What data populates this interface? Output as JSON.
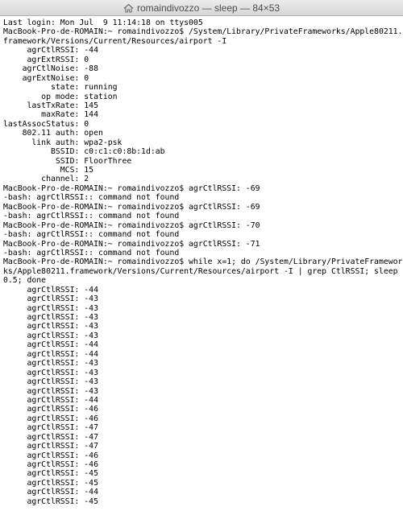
{
  "window": {
    "title": "romaindivozzo — sleep — 84×53",
    "title_icon": "home-folder-icon"
  },
  "terminal": {
    "lines": [
      "Last login: Mon Jul  9 11:14:18 on ttys005",
      "MacBook-Pro-de-ROMAIN:~ romaindivozzo$ /System/Library/PrivateFrameworks/Apple80211.",
      "framework/Versions/Current/Resources/airport -I",
      "     agrCtlRSSI: -44",
      "     agrExtRSSI: 0",
      "    agrCtlNoise: -88",
      "    agrExtNoise: 0",
      "          state: running",
      "        op mode: station",
      "     lastTxRate: 145",
      "        maxRate: 144",
      "lastAssocStatus: 0",
      "    802.11 auth: open",
      "      link auth: wpa2-psk",
      "          BSSID: c0:c1:c0:8b:1d:ab",
      "           SSID: FloorThree",
      "            MCS: 15",
      "        channel: 2",
      "MacBook-Pro-de-ROMAIN:~ romaindivozzo$ agrCtlRSSI: -69",
      "-bash: agrCtlRSSI:: command not found",
      "MacBook-Pro-de-ROMAIN:~ romaindivozzo$ agrCtlRSSI: -69",
      "-bash: agrCtlRSSI:: command not found",
      "MacBook-Pro-de-ROMAIN:~ romaindivozzo$ agrCtlRSSI: -70",
      "-bash: agrCtlRSSI:: command not found",
      "MacBook-Pro-de-ROMAIN:~ romaindivozzo$ agrCtlRSSI: -71",
      "-bash: agrCtlRSSI:: command not found",
      "MacBook-Pro-de-ROMAIN:~ romaindivozzo$ while x=1; do /System/Library/PrivateFramewor",
      "ks/Apple80211.framework/Versions/Current/Resources/airport -I | grep CtlRSSI; sleep",
      "0.5; done",
      "     agrCtlRSSI: -44",
      "     agrCtlRSSI: -43",
      "     agrCtlRSSI: -43",
      "     agrCtlRSSI: -43",
      "     agrCtlRSSI: -43",
      "     agrCtlRSSI: -43",
      "     agrCtlRSSI: -44",
      "     agrCtlRSSI: -44",
      "     agrCtlRSSI: -43",
      "     agrCtlRSSI: -43",
      "     agrCtlRSSI: -43",
      "     agrCtlRSSI: -43",
      "     agrCtlRSSI: -44",
      "     agrCtlRSSI: -46",
      "     agrCtlRSSI: -46",
      "     agrCtlRSSI: -47",
      "     agrCtlRSSI: -47",
      "     agrCtlRSSI: -47",
      "     agrCtlRSSI: -46",
      "     agrCtlRSSI: -46",
      "     agrCtlRSSI: -45",
      "     agrCtlRSSI: -45",
      "     agrCtlRSSI: -44",
      "     agrCtlRSSI: -45"
    ]
  }
}
